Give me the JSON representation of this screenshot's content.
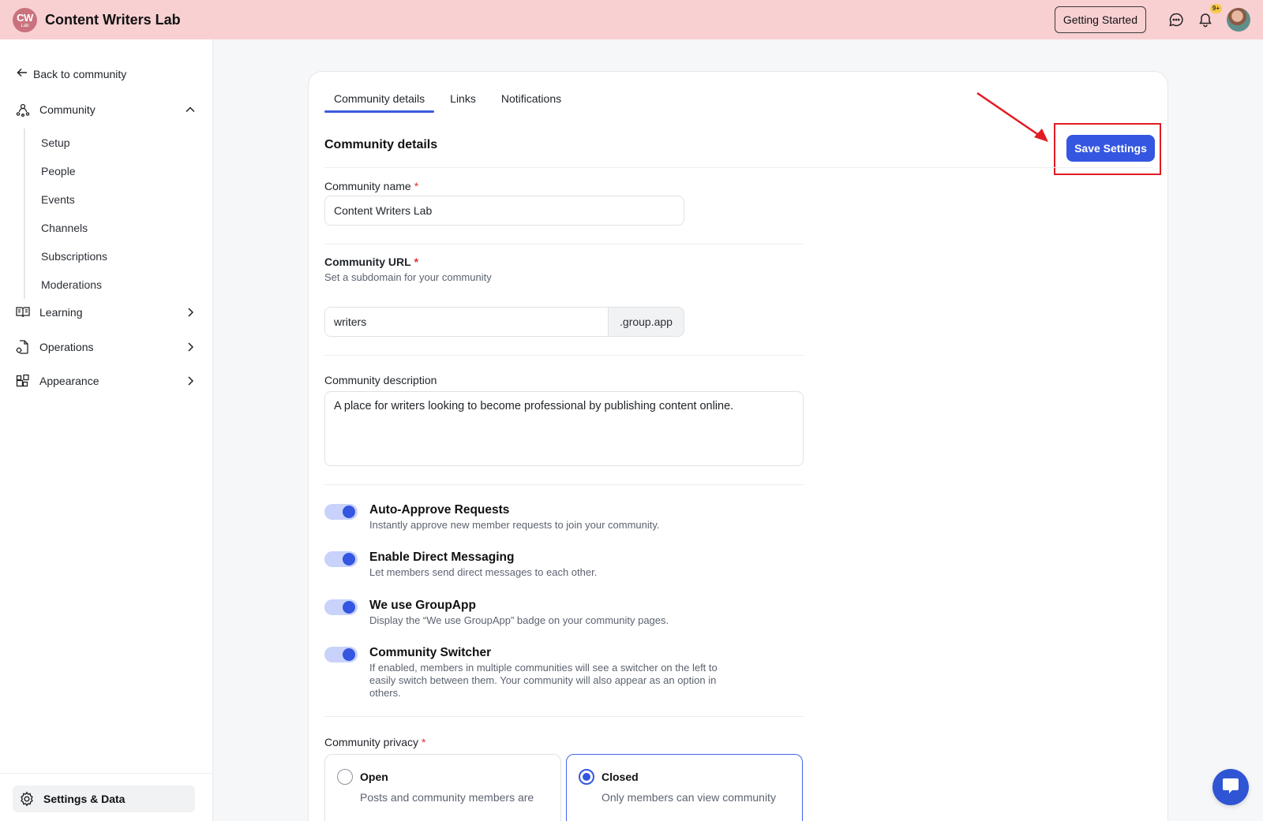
{
  "header": {
    "logo_text": "CW",
    "logo_sub": "Lab",
    "app_title": "Content Writers Lab",
    "getting_started_label": "Getting Started",
    "notification_badge": "9+"
  },
  "sidebar": {
    "back_label": "Back to community",
    "community_label": "Community",
    "community_items": [
      "Setup",
      "People",
      "Events",
      "Channels",
      "Subscriptions",
      "Moderations"
    ],
    "learning_label": "Learning",
    "operations_label": "Operations",
    "appearance_label": "Appearance",
    "settings_label": "Settings & Data"
  },
  "tabs": [
    "Community details",
    "Links",
    "Notifications"
  ],
  "form": {
    "section_title": "Community details",
    "save_label": "Save Settings",
    "name_label": "Community name",
    "name_value": "Content Writers Lab",
    "url_label": "Community URL",
    "url_helper": "Set a subdomain for your community",
    "url_value": "writers",
    "url_suffix": ".group.app",
    "description_label": "Community description",
    "description_value": "A place for writers looking to become professional by publishing content online.",
    "required_mark": "*"
  },
  "toggles": [
    {
      "title": "Auto-Approve Requests",
      "desc": "Instantly approve new member requests to join your community.",
      "on": true
    },
    {
      "title": "Enable Direct Messaging",
      "desc": "Let members send direct messages to each other.",
      "on": true
    },
    {
      "title": "We use GroupApp",
      "desc": "Display the “We use GroupApp” badge on your community pages.",
      "on": true
    },
    {
      "title": "Community Switcher",
      "desc": "If enabled, members in multiple communities will see a switcher on the left to easily switch between them. Your community will also appear as an option in others.",
      "on": true
    }
  ],
  "privacy": {
    "label": "Community privacy",
    "options": [
      {
        "title": "Open",
        "desc": "Posts and community members are",
        "selected": false
      },
      {
        "title": "Closed",
        "desc": "Only members can view community",
        "selected": true
      }
    ]
  },
  "colors": {
    "header_bg": "#f8d0d2",
    "accent": "#3456e0",
    "highlight": "#e21b23"
  }
}
